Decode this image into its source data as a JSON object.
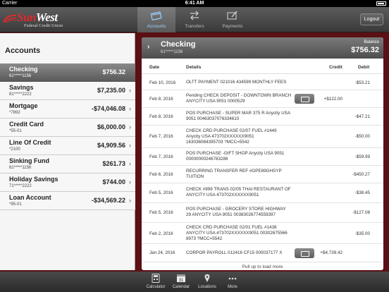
{
  "status_bar": {
    "carrier": "Carrier",
    "time": "6:41 AM"
  },
  "brand": {
    "name_part1": "Sun",
    "name_part2": "West",
    "subtitle": "Federal Credit Union"
  },
  "nav": {
    "tabs": [
      {
        "label": "Accounts",
        "icon": "credit-card-icon",
        "active": true
      },
      {
        "label": "Transfers",
        "icon": "transfer-arrows-icon",
        "active": false
      },
      {
        "label": "Payments",
        "icon": "pen-paper-icon",
        "active": false
      }
    ],
    "logout_label": "Logout"
  },
  "accounts_panel": {
    "title": "Accounts",
    "accounts": [
      {
        "name": "Checking",
        "number": "61*****1156",
        "balance": "$756.32"
      },
      {
        "name": "Savings",
        "number": "81*****2222",
        "balance": "$7,235.00"
      },
      {
        "name": "Mortgage",
        "number": "*7892",
        "balance": "-$74,046.08"
      },
      {
        "name": "Credit Card",
        "number": "*55-01",
        "balance": "$6,000.00"
      },
      {
        "name": "Line Of Credit",
        "number": "*2100",
        "balance": "$4,909.56"
      },
      {
        "name": "Sinking Fund",
        "number": "61*****1156",
        "balance": "$261.73"
      },
      {
        "name": "Holiday Savings",
        "number": "71*****2222",
        "balance": "$744.00"
      },
      {
        "name": "Loan Account",
        "number": "*95-01",
        "balance": "-$34,569.22"
      }
    ]
  },
  "detail": {
    "title": "Checking",
    "account_number": "61*****1156",
    "balance_label": "Balance",
    "balance_value": "$756.32",
    "columns": {
      "date": "Date",
      "details": "Details",
      "credit": "Credit",
      "debit": "Debit"
    },
    "transactions": [
      {
        "date": "Feb 10, 2016",
        "details": "OLTT PAYMENT 021016 434599 MONTHLY FEES",
        "credit": "",
        "debit": "-$53.21",
        "check_image": false
      },
      {
        "date": "Feb 8, 2016",
        "details": "Pending CHECK DEPOSIT - DOWNTOWN BRANCH ANYCITY USA 9051 0000529",
        "credit": "+$122.00",
        "debit": "",
        "check_image": true
      },
      {
        "date": "Feb 8, 2016",
        "details": "POS PURCHASE - SUPER MAR 375 R Anycity USA 9051 00463037076334610",
        "credit": "",
        "debit": "-$47.21",
        "check_image": false
      },
      {
        "date": "Feb 7, 2016",
        "details": "CHECK CRD PURCHASE 02/07 FUEL #1449 Anycity USA 473702XXXXXX9051 163036084395703 ?MCC=5542",
        "credit": "",
        "debit": "-$50.00",
        "check_image": false
      },
      {
        "date": "Feb 7, 2016",
        "details": "POS PURCHASE -GIFT SHOP Anycity USA 9051 00000000246783286",
        "credit": "",
        "debit": "-$59.99",
        "check_image": false
      },
      {
        "date": "Feb 6, 2016",
        "details": "RECURRING TRANSFER REF #OPE89GHSYP TUITION",
        "credit": "",
        "debit": "-$450.27",
        "check_image": false
      },
      {
        "date": "Feb 5, 2016",
        "details": "CHECK #999 TRANS 02/05 THAI RESTAURANT OF ANYCITY USA 473702XXXXXX9051",
        "credit": "",
        "debit": "-$38.45",
        "check_image": false
      },
      {
        "date": "Feb 5, 2016",
        "details": "POS PURCHASE - GROCERY STORE HIGHWAY 29 ANYCITY USA 9051 00383026774559397",
        "credit": "",
        "debit": "-$127.08",
        "check_image": false
      },
      {
        "date": "Feb 2, 2016",
        "details": "CHECK CRD PURCHASE 02/01 FUEL #1438 ANYCITY USA 473702XXXXXX9051 00302675566 8973 ?MCC=5542",
        "credit": "",
        "debit": "-$35.00",
        "check_image": false
      },
      {
        "date": "Jan 24, 2016",
        "details": "CORPOR PAYROLL 012416 CF15 000037177 X",
        "credit": "+$4,739.42",
        "debit": "",
        "check_image": true
      }
    ],
    "more_label": "Pull up to load more"
  },
  "bottom_bar": {
    "items": [
      {
        "label": "Calculator",
        "icon": "calculator-icon"
      },
      {
        "label": "Calendar",
        "icon": "calendar-icon",
        "day": "31"
      },
      {
        "label": "Locations",
        "icon": "location-pin-icon"
      },
      {
        "label": "More",
        "icon": "more-dots-icon"
      }
    ]
  },
  "colors": {
    "brand_red": "#e02a2a",
    "background": "#5a1014",
    "active_tab": "#9fd0ff"
  }
}
